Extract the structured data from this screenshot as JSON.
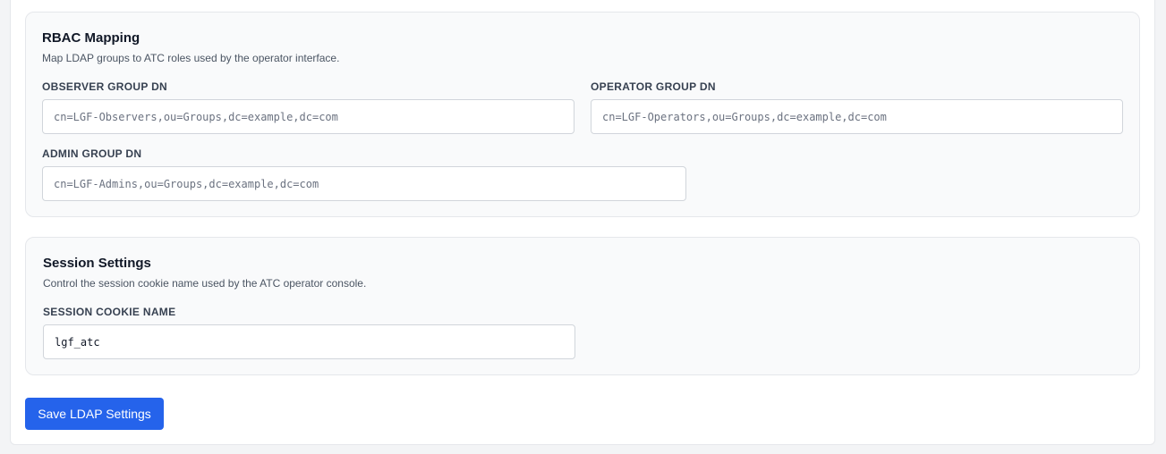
{
  "rbac": {
    "title": "RBAC Mapping",
    "description": "Map LDAP groups to ATC roles used by the operator interface.",
    "observer": {
      "label": "OBSERVER GROUP DN",
      "value": "",
      "placeholder": "cn=LGF-Observers,ou=Groups,dc=example,dc=com"
    },
    "operator": {
      "label": "OPERATOR GROUP DN",
      "value": "",
      "placeholder": "cn=LGF-Operators,ou=Groups,dc=example,dc=com"
    },
    "admin": {
      "label": "ADMIN GROUP DN",
      "value": "",
      "placeholder": "cn=LGF-Admins,ou=Groups,dc=example,dc=com"
    }
  },
  "session": {
    "title": "Session Settings",
    "description": "Control the session cookie name used by the ATC operator console.",
    "cookie": {
      "label": "SESSION COOKIE NAME",
      "value": "lgf_atc",
      "placeholder": ""
    }
  },
  "actions": {
    "save_label": "Save LDAP Settings"
  },
  "colors": {
    "primary": "#2563eb",
    "section_bg": "#f9fafb",
    "border": "#e5e7eb"
  }
}
